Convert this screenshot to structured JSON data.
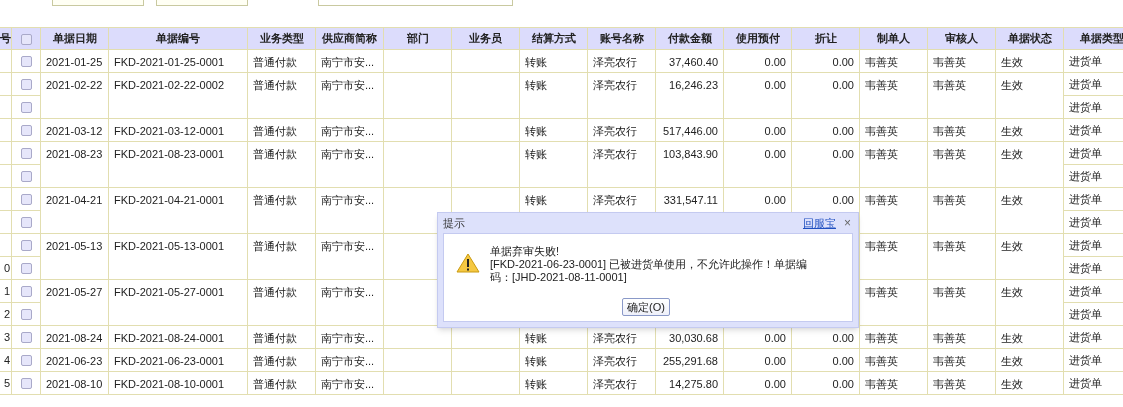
{
  "table": {
    "header_checkbox": {
      "checked": false
    },
    "columns": [
      "号",
      "单据日期",
      "单据编号",
      "业务类型",
      "供应商简称",
      "部门",
      "业务员",
      "结算方式",
      "账号名称",
      "付款金额",
      "使用预付",
      "折让",
      "制单人",
      "审核人",
      "单据状态",
      "单据类型"
    ],
    "rows": [
      {
        "date": "2021-01-25",
        "number": "FKD-2021-01-25-0001",
        "business_type": "普通付款",
        "supplier": "南宁市安...",
        "settlement": "转账",
        "account": "泽亮农行",
        "amount": "37,460.40",
        "prepaid": "0.00",
        "discount": "0.00",
        "maker": "韦善英",
        "checker": "韦善英",
        "status": "生效",
        "sub_rows": [
          {
            "row_number": "",
            "checked": false,
            "doc_type": "进货单"
          }
        ]
      },
      {
        "date": "2021-02-22",
        "number": "FKD-2021-02-22-0002",
        "business_type": "普通付款",
        "supplier": "南宁市安...",
        "settlement": "转账",
        "account": "泽亮农行",
        "amount": "16,246.23",
        "prepaid": "0.00",
        "discount": "0.00",
        "maker": "韦善英",
        "checker": "韦善英",
        "status": "生效",
        "sub_rows": [
          {
            "row_number": "",
            "checked": false,
            "doc_type": "进货单"
          },
          {
            "row_number": "",
            "checked": false,
            "doc_type": "进货单"
          }
        ]
      },
      {
        "date": "2021-03-12",
        "number": "FKD-2021-03-12-0001",
        "business_type": "普通付款",
        "supplier": "南宁市安...",
        "settlement": "转账",
        "account": "泽亮农行",
        "amount": "517,446.00",
        "prepaid": "0.00",
        "discount": "0.00",
        "maker": "韦善英",
        "checker": "韦善英",
        "status": "生效",
        "sub_rows": [
          {
            "row_number": "",
            "checked": false,
            "doc_type": "进货单"
          }
        ]
      },
      {
        "date": "2021-08-23",
        "number": "FKD-2021-08-23-0001",
        "business_type": "普通付款",
        "supplier": "南宁市安...",
        "settlement": "转账",
        "account": "泽亮农行",
        "amount": "103,843.90",
        "prepaid": "0.00",
        "discount": "0.00",
        "maker": "韦善英",
        "checker": "韦善英",
        "status": "生效",
        "sub_rows": [
          {
            "row_number": "",
            "checked": false,
            "doc_type": "进货单"
          },
          {
            "row_number": "",
            "checked": false,
            "doc_type": "进货单"
          }
        ]
      },
      {
        "date": "2021-04-21",
        "number": "FKD-2021-04-21-0001",
        "business_type": "普通付款",
        "supplier": "南宁市安...",
        "settlement": "转账",
        "account": "泽亮农行",
        "amount": "331,547.11",
        "prepaid": "0.00",
        "discount": "0.00",
        "maker": "韦善英",
        "checker": "韦善英",
        "status": "生效",
        "sub_rows": [
          {
            "row_number": "",
            "checked": false,
            "doc_type": "进货单"
          },
          {
            "row_number": "",
            "checked": false,
            "doc_type": "进货单"
          }
        ]
      },
      {
        "date": "2021-05-13",
        "number": "FKD-2021-05-13-0001",
        "business_type": "普通付款",
        "supplier": "南宁市安...",
        "settlement": "",
        "account": "",
        "amount": "",
        "prepaid": "",
        "discount": "",
        "maker": "韦善英",
        "checker": "韦善英",
        "status": "生效",
        "sub_rows": [
          {
            "row_number": "",
            "checked": false,
            "doc_type": "进货单"
          },
          {
            "row_number": "0",
            "checked": false,
            "doc_type": "进货单"
          }
        ]
      },
      {
        "date": "2021-05-27",
        "number": "FKD-2021-05-27-0001",
        "business_type": "普通付款",
        "supplier": "南宁市安...",
        "settlement": "",
        "account": "",
        "amount": "",
        "prepaid": "",
        "discount": "",
        "maker": "韦善英",
        "checker": "韦善英",
        "status": "生效",
        "sub_rows": [
          {
            "row_number": "1",
            "checked": false,
            "doc_type": "进货单"
          },
          {
            "row_number": "2",
            "checked": false,
            "doc_type": "进货单"
          }
        ]
      },
      {
        "date": "2021-08-24",
        "number": "FKD-2021-08-24-0001",
        "business_type": "普通付款",
        "supplier": "南宁市安...",
        "settlement": "转账",
        "account": "泽亮农行",
        "amount": "30,030.68",
        "prepaid": "0.00",
        "discount": "0.00",
        "maker": "韦善英",
        "checker": "韦善英",
        "status": "生效",
        "sub_rows": [
          {
            "row_number": "3",
            "checked": false,
            "doc_type": "进货单"
          }
        ]
      },
      {
        "date": "2021-06-23",
        "number": "FKD-2021-06-23-0001",
        "business_type": "普通付款",
        "supplier": "南宁市安...",
        "settlement": "转账",
        "account": "泽亮农行",
        "amount": "255,291.68",
        "prepaid": "0.00",
        "discount": "0.00",
        "maker": "韦善英",
        "checker": "韦善英",
        "status": "生效",
        "sub_rows": [
          {
            "row_number": "4",
            "checked": false,
            "doc_type": "进货单"
          }
        ]
      },
      {
        "date": "2021-08-10",
        "number": "FKD-2021-08-10-0001",
        "business_type": "普通付款",
        "supplier": "南宁市安...",
        "settlement": "转账",
        "account": "泽亮农行",
        "amount": "14,275.80",
        "prepaid": "0.00",
        "discount": "0.00",
        "maker": "韦善英",
        "checker": "韦善英",
        "status": "生效",
        "sub_rows": [
          {
            "row_number": "5",
            "checked": false,
            "doc_type": "进货单"
          }
        ]
      }
    ]
  },
  "dialog": {
    "title": "提示",
    "link": "回服宝",
    "close": "×",
    "message_title": "单据弃审失败!",
    "message": "[FKD-2021-06-23-0001] 已被进货单使用，不允许此操作！单据编码：[JHD-2021-08-11-0001]",
    "button": "确定(O)"
  }
}
